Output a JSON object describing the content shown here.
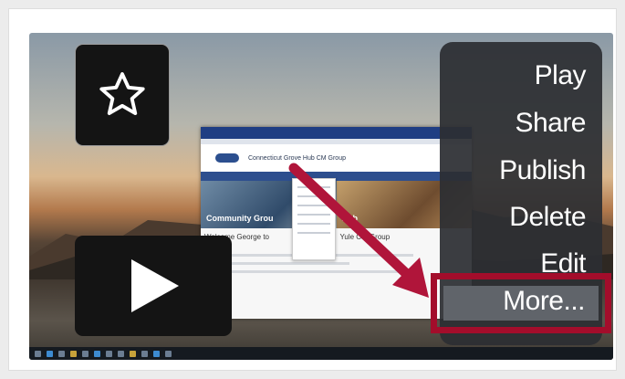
{
  "media_card": {
    "favorite_icon": "star-outline-icon",
    "play_icon": "play-icon",
    "thumbnail": {
      "site_title": "Connecticut Grove Hub CM Group",
      "hero_left_text": "Community Grou",
      "hero_right_text": "Hub",
      "welcome_left": "Welcome George to",
      "welcome_right": "Yule CM Group"
    }
  },
  "context_menu": {
    "items": [
      {
        "label": "Play"
      },
      {
        "label": "Share"
      },
      {
        "label": "Publish"
      },
      {
        "label": "Delete"
      },
      {
        "label": "Edit"
      },
      {
        "label": "More..."
      }
    ],
    "highlighted_item": "More...",
    "highlight_color": "#a30d2b",
    "arrow_color": "#b0153a"
  }
}
